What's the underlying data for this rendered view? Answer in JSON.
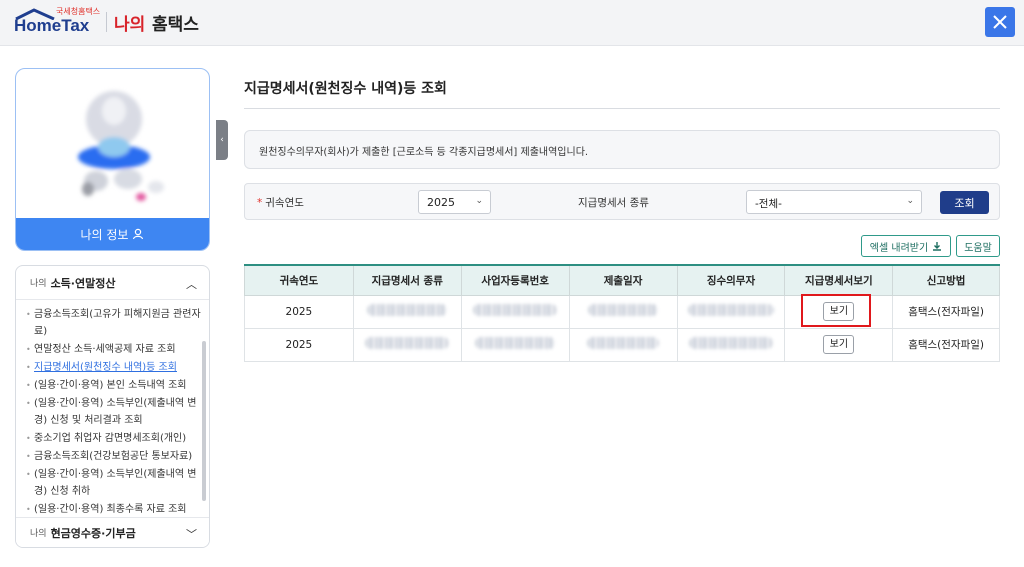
{
  "header": {
    "logo_sub": "국세청홈택스",
    "logo_main": "HomeTax",
    "my_label": "나의",
    "hometax_label": "홈택스"
  },
  "profile": {
    "button_label": "나의 정보"
  },
  "sidebar": {
    "section1": {
      "prefix": "나의",
      "title": "소득·연말정산"
    },
    "items": [
      "금융소득조회(고유가 피해지원금 관련자료)",
      "연말정산 소득·세액공제 자료 조회",
      "지급명세서(원천징수 내역)등 조회",
      "(일용·간이·용역) 본인 소득내역 조회",
      "(일용·간이·용역) 소득부인(제출내역 변경) 신청 및 처리결과 조회",
      "중소기업 취업자 감면명세조회(개인)",
      "금융소득조회(건강보험공단 통보자료)",
      "(일용·간이·용역) 소득부인(제출내역 변경) 신청 취하",
      "(일용·간이·용역) 최종수록 자료 조회"
    ],
    "section2": {
      "prefix": "나의",
      "title": "현금영수증·기부금"
    }
  },
  "main": {
    "title": "지급명세서(원천징수 내역)등 조회",
    "notice": "원천징수의무자(회사)가 제출한 [근로소득 등 각종지급명세서] 제출내역입니다.",
    "search": {
      "year_label": "귀속연도",
      "year_value": "2025",
      "type_label": "지급명세서 종류",
      "type_value": "-전체-",
      "search_button": "조회"
    },
    "excel_button": "엑셀 내려받기",
    "help_button": "도움말",
    "table": {
      "headers": [
        "귀속연도",
        "지급명세서 종류",
        "사업자등록번호",
        "제출일자",
        "징수의무자",
        "지급명세서보기",
        "신고방법"
      ],
      "rows": [
        {
          "year": "2025",
          "view": "보기",
          "method": "홈택스(전자파일)"
        },
        {
          "year": "2025",
          "view": "보기",
          "method": "홈택스(전자파일)"
        }
      ]
    }
  },
  "colors": {
    "brand_blue": "#3e86f2",
    "navy": "#1f3d8a",
    "teal": "#2d8f82",
    "highlight_red": "#e0181c"
  }
}
